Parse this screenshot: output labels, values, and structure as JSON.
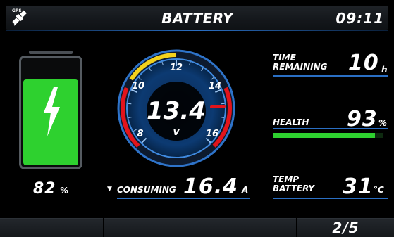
{
  "header": {
    "gps_label": "GPS",
    "title": "BATTERY",
    "clock": "09:11"
  },
  "battery": {
    "percent_value": "82",
    "percent_unit": "%",
    "level_fraction": 0.82,
    "fill_color": "#2ed12f"
  },
  "gauge": {
    "reading": "13.4",
    "unit": "V",
    "ticks": [
      "8",
      "10",
      "12",
      "14",
      "16"
    ],
    "value": 13.4,
    "range": [
      8,
      16
    ],
    "needle_at": 14.6,
    "colors": {
      "ring": "#1b6fd1",
      "low_zone": "#e3141b",
      "high_zone": "#e3141b",
      "warn_zone": "#f4d21c",
      "needle": "#e3141b"
    }
  },
  "consuming": {
    "arrow": "▼",
    "label": "CONSUMING",
    "value": "16.4",
    "unit": "A"
  },
  "stats": {
    "time_remaining": {
      "label_line1": "TIME",
      "label_line2": "REMAINING",
      "value": "10",
      "unit": "h"
    },
    "health": {
      "label": "HEALTH",
      "value": "93",
      "unit": "%",
      "level_fraction": 0.93
    },
    "temp_battery": {
      "label_line1": "TEMP",
      "label_line2": "BATTERY",
      "value": "31",
      "unit": "°C"
    }
  },
  "footer": {
    "page_indicator": "2/5"
  },
  "colors": {
    "accent_line": "#2a6fc4",
    "background": "#000000"
  }
}
